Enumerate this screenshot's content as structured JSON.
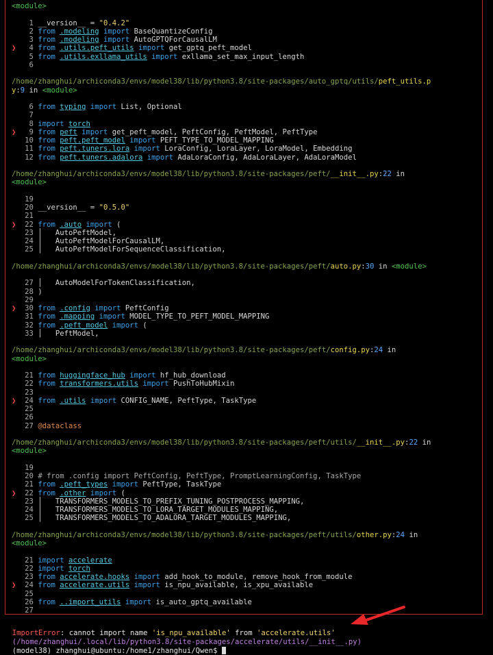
{
  "frames": [
    {
      "header": [
        {
          "t": "<module>",
          "c": "green"
        }
      ],
      "lines": [
        {
          "n": "1",
          "mark": false,
          "segs": [
            {
              "t": "__version__ = ",
              "c": ""
            },
            {
              "t": "\"0.4.2\"",
              "c": "str"
            }
          ]
        },
        {
          "n": "2",
          "mark": false,
          "segs": [
            {
              "t": "from ",
              "c": "kw"
            },
            {
              "t": ".modeling",
              "c": "cyan"
            },
            {
              "t": " import ",
              "c": "kw"
            },
            {
              "t": "BaseQuantizeConfig",
              "c": ""
            }
          ]
        },
        {
          "n": "3",
          "mark": false,
          "segs": [
            {
              "t": "from ",
              "c": "kw"
            },
            {
              "t": ".modeling",
              "c": "cyan"
            },
            {
              "t": " import ",
              "c": "kw"
            },
            {
              "t": "AutoGPTQForCausalLM",
              "c": ""
            }
          ]
        },
        {
          "n": "4",
          "mark": true,
          "segs": [
            {
              "t": "from ",
              "c": "kw"
            },
            {
              "t": ".utils.peft_utils",
              "c": "cyan"
            },
            {
              "t": " import ",
              "c": "kw"
            },
            {
              "t": "get_gptq_peft_model",
              "c": ""
            }
          ]
        },
        {
          "n": "5",
          "mark": false,
          "segs": [
            {
              "t": "from ",
              "c": "kw"
            },
            {
              "t": ".utils.exllama_utils",
              "c": "cyan"
            },
            {
              "t": " import ",
              "c": "kw"
            },
            {
              "t": "exllama_set_max_input_length",
              "c": ""
            }
          ]
        },
        {
          "n": "6",
          "mark": false,
          "segs": []
        }
      ]
    },
    {
      "header": [
        {
          "t": "/home/zhanghui/archiconda3/envs/model38/lib/python3.8/site-packages/auto_gptq/utils/",
          "c": "path"
        },
        {
          "t": "peft_utils.p",
          "c": "yellow"
        }
      ],
      "header2": [
        {
          "t": "y",
          "c": "yellow"
        },
        {
          "t": ":",
          "c": ""
        },
        {
          "t": "9",
          "c": "blue"
        },
        {
          "t": " in ",
          "c": ""
        },
        {
          "t": "<module>",
          "c": "green"
        }
      ],
      "lines": [
        {
          "n": "6",
          "mark": false,
          "segs": [
            {
              "t": "from ",
              "c": "kw"
            },
            {
              "t": "typing",
              "c": "cyan"
            },
            {
              "t": " import ",
              "c": "kw"
            },
            {
              "t": "List, Optional",
              "c": ""
            }
          ]
        },
        {
          "n": "7",
          "mark": false,
          "segs": []
        },
        {
          "n": "8",
          "mark": false,
          "segs": [
            {
              "t": "import ",
              "c": "kw"
            },
            {
              "t": "torch",
              "c": "cyan"
            }
          ]
        },
        {
          "n": "9",
          "mark": true,
          "segs": [
            {
              "t": "from ",
              "c": "kw"
            },
            {
              "t": "peft",
              "c": "cyan"
            },
            {
              "t": " import ",
              "c": "kw"
            },
            {
              "t": "get_peft_model, PeftConfig, PeftModel, PeftType",
              "c": ""
            }
          ]
        },
        {
          "n": "10",
          "mark": false,
          "segs": [
            {
              "t": "from ",
              "c": "kw"
            },
            {
              "t": "peft.peft_model",
              "c": "cyan"
            },
            {
              "t": " import ",
              "c": "kw"
            },
            {
              "t": "PEFT_TYPE_TO_MODEL_MAPPING",
              "c": ""
            }
          ]
        },
        {
          "n": "11",
          "mark": false,
          "segs": [
            {
              "t": "from ",
              "c": "kw"
            },
            {
              "t": "peft.tuners.lora",
              "c": "cyan"
            },
            {
              "t": " import ",
              "c": "kw"
            },
            {
              "t": "LoraConfig, LoraLayer, LoraModel, Embedding",
              "c": ""
            }
          ]
        },
        {
          "n": "12",
          "mark": false,
          "segs": [
            {
              "t": "from ",
              "c": "kw"
            },
            {
              "t": "peft.tuners.adalora",
              "c": "cyan"
            },
            {
              "t": " import ",
              "c": "kw"
            },
            {
              "t": "AdaLoraConfig, AdaLoraLayer, AdaLoraModel",
              "c": ""
            }
          ]
        }
      ]
    },
    {
      "header": [
        {
          "t": "/home/zhanghui/archiconda3/envs/model38/lib/python3.8/site-packages/peft/",
          "c": "path"
        },
        {
          "t": "__init__.py",
          "c": "yellow"
        },
        {
          "t": ":",
          "c": ""
        },
        {
          "t": "22",
          "c": "blue"
        },
        {
          "t": " in",
          "c": ""
        }
      ],
      "header2": [
        {
          "t": "<module>",
          "c": "green"
        }
      ],
      "lines": [
        {
          "n": "19",
          "mark": false,
          "segs": []
        },
        {
          "n": "20",
          "mark": false,
          "segs": [
            {
              "t": "__version__ = ",
              "c": ""
            },
            {
              "t": "\"0.5.0\"",
              "c": "str"
            }
          ]
        },
        {
          "n": "21",
          "mark": false,
          "segs": []
        },
        {
          "n": "22",
          "mark": true,
          "segs": [
            {
              "t": "from ",
              "c": "kw"
            },
            {
              "t": ".auto",
              "c": "cyan"
            },
            {
              "t": " import ",
              "c": "kw"
            },
            {
              "t": "(",
              "c": ""
            }
          ]
        },
        {
          "n": "23",
          "mark": false,
          "segs": [
            {
              "t": "│   AutoPeftModel,",
              "c": ""
            }
          ]
        },
        {
          "n": "24",
          "mark": false,
          "segs": [
            {
              "t": "│   AutoPeftModelForCausalLM,",
              "c": ""
            }
          ]
        },
        {
          "n": "25",
          "mark": false,
          "segs": [
            {
              "t": "│   AutoPeftModelForSequenceClassification,",
              "c": ""
            }
          ]
        }
      ]
    },
    {
      "header": [
        {
          "t": "/home/zhanghui/archiconda3/envs/model38/lib/python3.8/site-packages/peft/",
          "c": "path"
        },
        {
          "t": "auto.py",
          "c": "yellow"
        },
        {
          "t": ":",
          "c": ""
        },
        {
          "t": "30",
          "c": "blue"
        },
        {
          "t": " in ",
          "c": ""
        },
        {
          "t": "<module>",
          "c": "green"
        }
      ],
      "lines": [
        {
          "n": "27",
          "mark": false,
          "segs": [
            {
              "t": "│   AutoModelForTokenClassification,",
              "c": ""
            }
          ]
        },
        {
          "n": "28",
          "mark": false,
          "segs": [
            {
              "t": ")",
              "c": ""
            }
          ]
        },
        {
          "n": "29",
          "mark": false,
          "segs": []
        },
        {
          "n": "30",
          "mark": true,
          "segs": [
            {
              "t": "from ",
              "c": "kw"
            },
            {
              "t": ".config",
              "c": "cyan"
            },
            {
              "t": " import ",
              "c": "kw"
            },
            {
              "t": "PeftConfig",
              "c": ""
            }
          ]
        },
        {
          "n": "31",
          "mark": false,
          "segs": [
            {
              "t": "from ",
              "c": "kw"
            },
            {
              "t": ".mapping",
              "c": "cyan"
            },
            {
              "t": " import ",
              "c": "kw"
            },
            {
              "t": "MODEL_TYPE_TO_PEFT_MODEL_MAPPING",
              "c": ""
            }
          ]
        },
        {
          "n": "32",
          "mark": false,
          "segs": [
            {
              "t": "from ",
              "c": "kw"
            },
            {
              "t": ".peft_model",
              "c": "cyan"
            },
            {
              "t": " import ",
              "c": "kw"
            },
            {
              "t": "(",
              "c": ""
            }
          ]
        },
        {
          "n": "33",
          "mark": false,
          "segs": [
            {
              "t": "│   PeftModel,",
              "c": ""
            }
          ]
        }
      ]
    },
    {
      "header": [
        {
          "t": "/home/zhanghui/archiconda3/envs/model38/lib/python3.8/site-packages/peft/",
          "c": "path"
        },
        {
          "t": "config.py",
          "c": "yellow"
        },
        {
          "t": ":",
          "c": ""
        },
        {
          "t": "24",
          "c": "blue"
        },
        {
          "t": " in",
          "c": ""
        }
      ],
      "header2": [
        {
          "t": "<module>",
          "c": "green"
        }
      ],
      "lines": [
        {
          "n": "21",
          "mark": false,
          "segs": [
            {
              "t": "from ",
              "c": "kw"
            },
            {
              "t": "huggingface_hub",
              "c": "cyan"
            },
            {
              "t": " import ",
              "c": "kw"
            },
            {
              "t": "hf_hub_download",
              "c": ""
            }
          ]
        },
        {
          "n": "22",
          "mark": false,
          "segs": [
            {
              "t": "from ",
              "c": "kw"
            },
            {
              "t": "transformers.utils",
              "c": "cyan"
            },
            {
              "t": " import ",
              "c": "kw"
            },
            {
              "t": "PushToHubMixin",
              "c": ""
            }
          ]
        },
        {
          "n": "23",
          "mark": false,
          "segs": []
        },
        {
          "n": "24",
          "mark": true,
          "segs": [
            {
              "t": "from ",
              "c": "kw"
            },
            {
              "t": ".utils",
              "c": "cyan"
            },
            {
              "t": " import ",
              "c": "kw"
            },
            {
              "t": "CONFIG_NAME, PeftType, TaskType",
              "c": ""
            }
          ]
        },
        {
          "n": "25",
          "mark": false,
          "segs": []
        },
        {
          "n": "26",
          "mark": false,
          "segs": []
        },
        {
          "n": "27",
          "mark": false,
          "segs": [
            {
              "t": "@dataclass",
              "c": "deco"
            }
          ]
        }
      ]
    },
    {
      "header": [
        {
          "t": "/home/zhanghui/archiconda3/envs/model38/lib/python3.8/site-packages/peft/utils/",
          "c": "path"
        },
        {
          "t": "__init__.py",
          "c": "yellow"
        },
        {
          "t": ":",
          "c": ""
        },
        {
          "t": "22",
          "c": "blue"
        },
        {
          "t": " in",
          "c": ""
        }
      ],
      "header2": [
        {
          "t": "<module>",
          "c": "green"
        }
      ],
      "lines": [
        {
          "n": "19",
          "mark": false,
          "segs": []
        },
        {
          "n": "20",
          "mark": false,
          "segs": [
            {
              "t": "# from .config import PeftConfig, PeftType, PromptLearningConfig, TaskType",
              "c": "gut"
            }
          ]
        },
        {
          "n": "21",
          "mark": false,
          "segs": [
            {
              "t": "from ",
              "c": "kw"
            },
            {
              "t": ".peft_types",
              "c": "cyan"
            },
            {
              "t": " import ",
              "c": "kw"
            },
            {
              "t": "PeftType, TaskType",
              "c": ""
            }
          ]
        },
        {
          "n": "22",
          "mark": true,
          "segs": [
            {
              "t": "from ",
              "c": "kw"
            },
            {
              "t": ".other",
              "c": "cyan"
            },
            {
              "t": " import ",
              "c": "kw"
            },
            {
              "t": "(",
              "c": ""
            }
          ]
        },
        {
          "n": "23",
          "mark": false,
          "segs": [
            {
              "t": "│   TRANSFORMERS_MODELS_TO_PREFIX_TUNING_POSTPROCESS_MAPPING,",
              "c": ""
            }
          ]
        },
        {
          "n": "24",
          "mark": false,
          "segs": [
            {
              "t": "│   TRANSFORMERS_MODELS_TO_LORA_TARGET_MODULES_MAPPING,",
              "c": ""
            }
          ]
        },
        {
          "n": "25",
          "mark": false,
          "segs": [
            {
              "t": "│   TRANSFORMERS_MODELS_TO_ADALORA_TARGET_MODULES_MAPPING,",
              "c": ""
            }
          ]
        }
      ]
    },
    {
      "header": [
        {
          "t": "/home/zhanghui/archiconda3/envs/model38/lib/python3.8/site-packages/peft/utils/",
          "c": "path"
        },
        {
          "t": "other.py",
          "c": "yellow"
        },
        {
          "t": ":",
          "c": ""
        },
        {
          "t": "24",
          "c": "blue"
        },
        {
          "t": " in",
          "c": ""
        }
      ],
      "header2": [
        {
          "t": "<module>",
          "c": "green"
        }
      ],
      "lines": [
        {
          "n": "21",
          "mark": false,
          "segs": [
            {
              "t": "import ",
              "c": "kw"
            },
            {
              "t": "accelerate",
              "c": "cyan"
            }
          ]
        },
        {
          "n": "22",
          "mark": false,
          "segs": [
            {
              "t": "import ",
              "c": "kw"
            },
            {
              "t": "torch",
              "c": "cyan"
            }
          ]
        },
        {
          "n": "23",
          "mark": false,
          "segs": [
            {
              "t": "from ",
              "c": "kw"
            },
            {
              "t": "accelerate.hooks",
              "c": "cyan"
            },
            {
              "t": " import ",
              "c": "kw"
            },
            {
              "t": "add_hook_to_module, remove_hook_from_module",
              "c": ""
            }
          ]
        },
        {
          "n": "24",
          "mark": true,
          "segs": [
            {
              "t": "from ",
              "c": "kw"
            },
            {
              "t": "accelerate.utils",
              "c": "cyan"
            },
            {
              "t": " import ",
              "c": "kw"
            },
            {
              "t": "is_npu_available, is_xpu_available",
              "c": ""
            }
          ]
        },
        {
          "n": "25",
          "mark": false,
          "segs": []
        },
        {
          "n": "26",
          "mark": false,
          "segs": [
            {
              "t": "from ",
              "c": "kw"
            },
            {
              "t": "..import_utils",
              "c": "cyan"
            },
            {
              "t": " import ",
              "c": "kw"
            },
            {
              "t": "is_auto_gptq_available",
              "c": ""
            }
          ]
        },
        {
          "n": "27",
          "mark": false,
          "segs": []
        }
      ]
    }
  ],
  "arrow_glyph": "❯",
  "error": {
    "label": "ImportError",
    "colon": ": ",
    "text1": "cannot import name ",
    "name": "'is_npu_available'",
    "text2": " from ",
    "module": "'accelerate.utils'",
    "path": "(/home/zhanghui/.local/lib/python3.8/site-packages/accelerate/utils/__init__.py)"
  },
  "prompt": {
    "text": "(model38) zhanghui@ubuntu:/home1/zhanghui/Qwen$ "
  },
  "colors": {
    "frame_border": "#c42b2b",
    "annotation_arrow": "#e8272a"
  }
}
